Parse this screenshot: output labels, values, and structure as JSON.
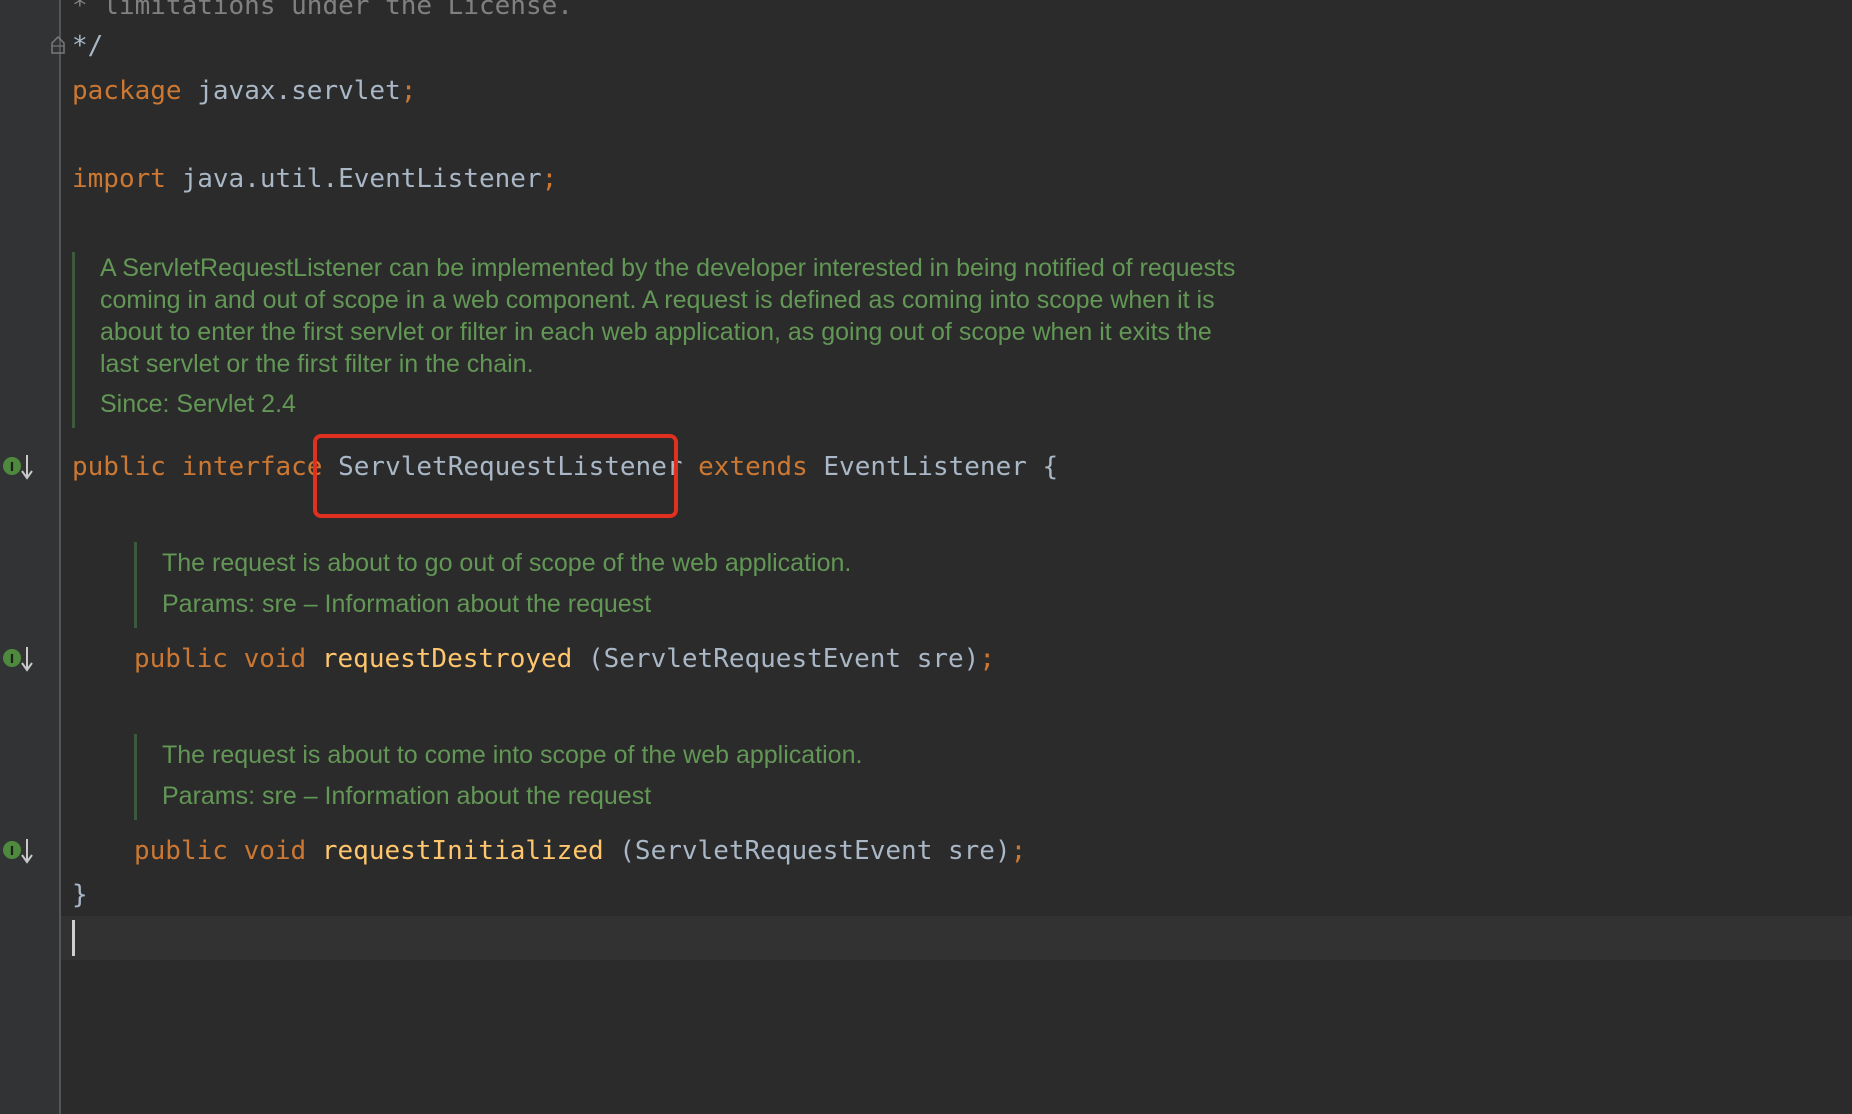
{
  "code": {
    "comment_top": "* limitations under the License.",
    "comment_end": "*/",
    "package": {
      "keyword": "package",
      "name": "javax.servlet",
      "semi": ";"
    },
    "import": {
      "keyword": "import",
      "name": "java.util.EventListener",
      "semi": ";"
    },
    "interface_decl": {
      "mod": "public",
      "kw": "interface",
      "name": "ServletRequestListener",
      "extends_kw": "extends",
      "parent": "EventListener",
      "brace": "{"
    },
    "method1": {
      "mod": "public",
      "type": "void",
      "name": "requestDestroyed",
      "params": "(ServletRequestEvent sre)",
      "semi": ";"
    },
    "method2": {
      "mod": "public",
      "type": "void",
      "name": "requestInitialized",
      "params": "(ServletRequestEvent sre)",
      "semi": ";"
    },
    "close_brace": "}"
  },
  "docs": {
    "class_doc": {
      "lines": [
        "A ServletRequestListener can be implemented by the developer interested in being notified of requests",
        "coming in and out of scope in a web component. A request is defined as coming into scope when it is",
        "about to enter the first servlet or filter in each web application, as going out of scope when it exits the",
        "last servlet or the first filter in the chain."
      ],
      "since": "Since: Servlet 2.4"
    },
    "method1_doc": {
      "text": "The request is about to go out of scope of the web application.",
      "params": "Params: sre – Information about the request"
    },
    "method2_doc": {
      "text": "The request is about to come into scope of the web application.",
      "params": "Params: sre – Information about the request"
    }
  },
  "gutter_icons": [
    "implemented-interface-icon",
    "implemented-method-icon",
    "implemented-method-icon"
  ],
  "colors": {
    "background": "#2b2b2b",
    "keyword": "#cc7832",
    "method": "#ffc66d",
    "identifier": "#a9b7c6",
    "doc": "#629755",
    "highlight": "#e0301e"
  }
}
